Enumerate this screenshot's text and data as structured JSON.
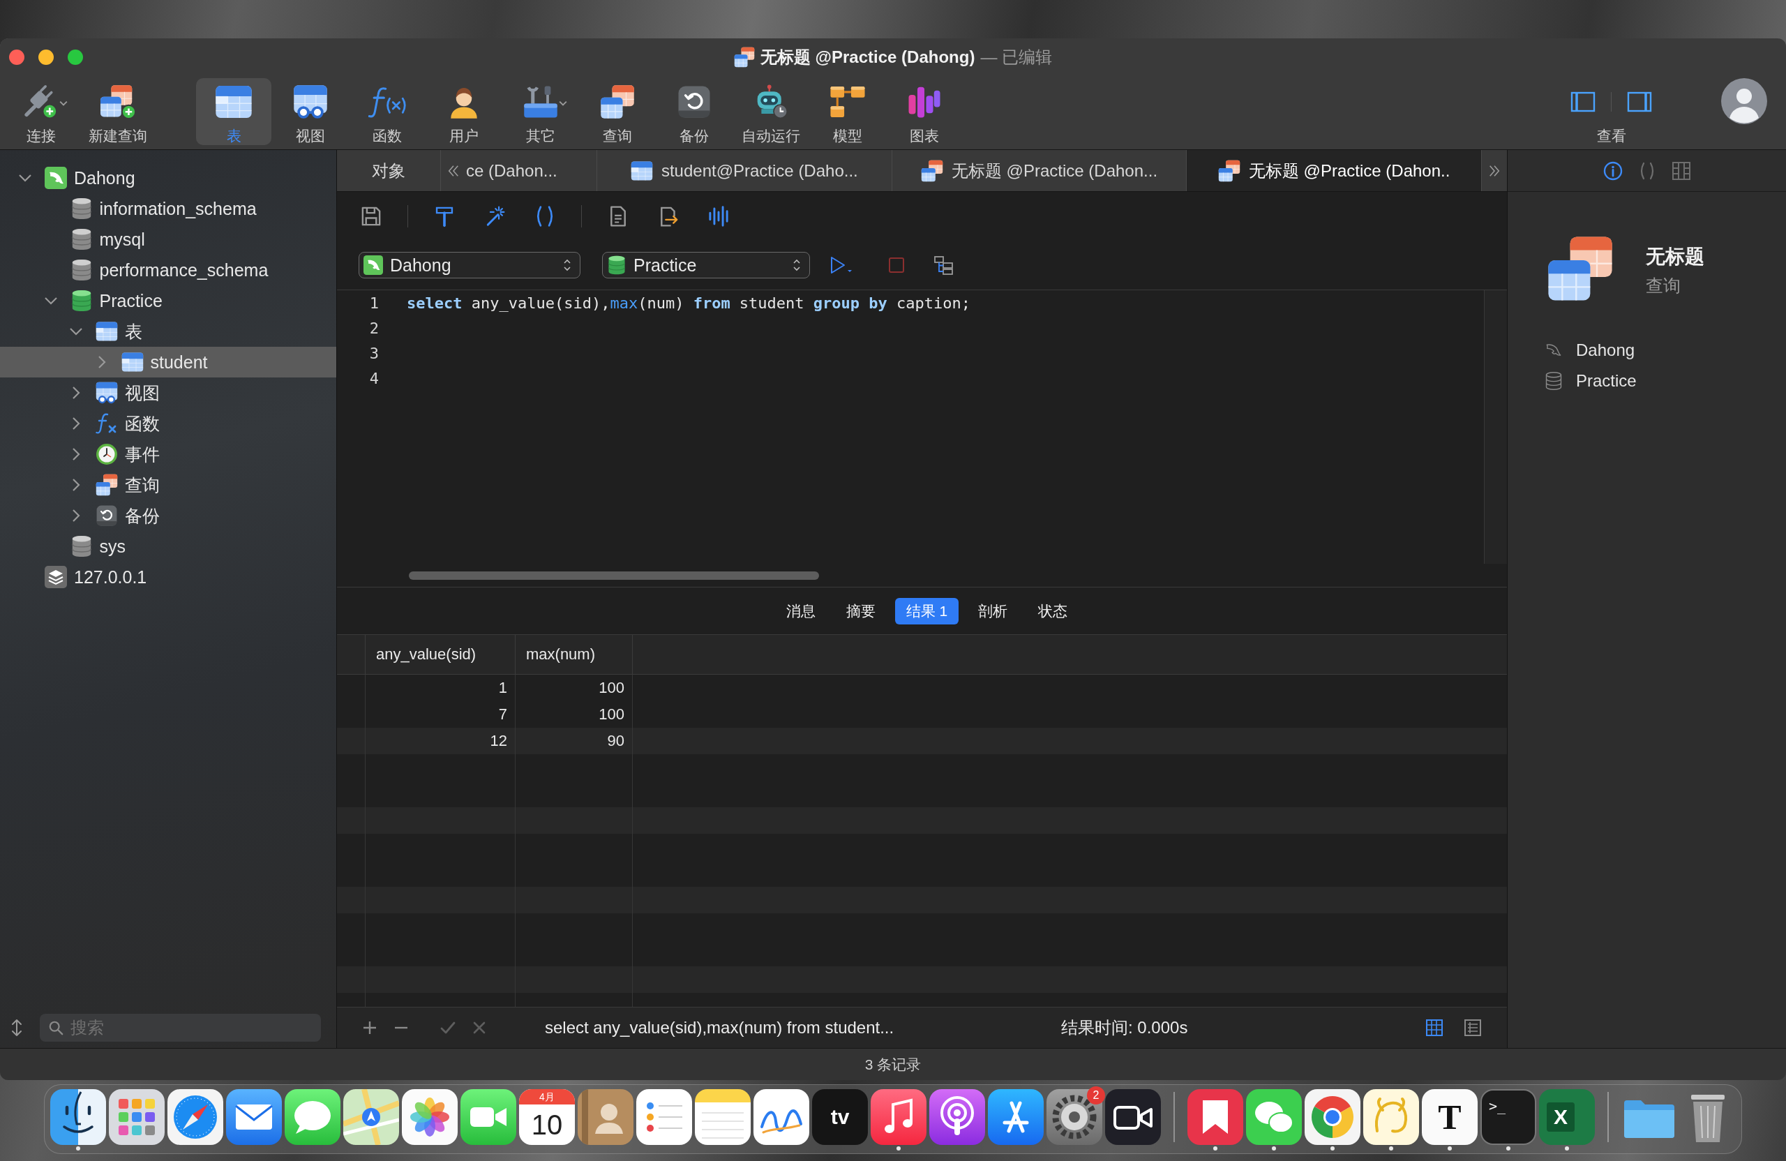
{
  "window": {
    "controls": [
      {
        "kind": "close"
      },
      {
        "kind": "minimize"
      },
      {
        "kind": "zoom"
      }
    ],
    "title": "无标题 @Practice (Dahong)",
    "status": "— 已编辑"
  },
  "toolbar": {
    "items": [
      {
        "label": "连接",
        "kind": "connect",
        "selected": false,
        "has_menu": true
      },
      {
        "label": "新建查询",
        "kind": "new-query",
        "selected": false,
        "has_menu": false
      },
      {
        "label": "表",
        "kind": "table",
        "selected": true,
        "has_menu": false
      },
      {
        "label": "视图",
        "kind": "view",
        "selected": false,
        "has_menu": false
      },
      {
        "label": "函数",
        "kind": "function",
        "selected": false,
        "has_menu": false
      },
      {
        "label": "用户",
        "kind": "user",
        "selected": false,
        "has_menu": false
      },
      {
        "label": "其它",
        "kind": "other",
        "selected": false,
        "has_menu": true
      },
      {
        "label": "查询",
        "kind": "query",
        "selected": false,
        "has_menu": false
      },
      {
        "label": "备份",
        "kind": "backup",
        "selected": false,
        "has_menu": false
      },
      {
        "label": "自动运行",
        "kind": "automation",
        "selected": false,
        "has_menu": false
      },
      {
        "label": "模型",
        "kind": "model",
        "selected": false,
        "has_menu": false
      },
      {
        "label": "图表",
        "kind": "chart",
        "selected": false,
        "has_menu": false
      }
    ],
    "view": {
      "label": "查看",
      "panes": [
        {
          "kind": "left",
          "on": true
        },
        {
          "kind": "right",
          "on": true
        }
      ]
    }
  },
  "sidebar": {
    "tree": [
      {
        "label": "Dahong",
        "kind": "connection",
        "expanded": true,
        "selected": false,
        "children": [
          {
            "label": "information_schema",
            "kind": "database",
            "selected": false
          },
          {
            "label": "mysql",
            "kind": "database",
            "selected": false
          },
          {
            "label": "performance_schema",
            "kind": "database",
            "selected": false
          },
          {
            "label": "Practice",
            "kind": "open-database",
            "expanded": true,
            "selected": false,
            "children": [
              {
                "label": "表",
                "kind": "tables",
                "expanded": true,
                "selected": false,
                "children": [
                  {
                    "label": "student",
                    "kind": "table",
                    "expanded": false,
                    "selected": true
                  }
                ]
              },
              {
                "label": "视图",
                "kind": "views",
                "expanded": false,
                "selected": false
              },
              {
                "label": "函数",
                "kind": "functions",
                "expanded": false,
                "selected": false
              },
              {
                "label": "事件",
                "kind": "events",
                "expanded": false,
                "selected": false
              },
              {
                "label": "查询",
                "kind": "queries",
                "expanded": false,
                "selected": false
              },
              {
                "label": "备份",
                "kind": "backups",
                "expanded": false,
                "selected": false
              }
            ]
          },
          {
            "label": "sys",
            "kind": "database",
            "selected": false
          }
        ]
      },
      {
        "label": "127.0.0.1",
        "kind": "server",
        "selected": false
      }
    ],
    "search": {
      "placeholder": "搜索"
    }
  },
  "tabs": [
    {
      "label": "对象",
      "kind": "text",
      "selected": false
    },
    {
      "label": "ce (Dahon...",
      "kind": "text",
      "selected": false
    },
    {
      "label": "student@Practice (Daho...",
      "kind": "table",
      "selected": false
    },
    {
      "label": "无标题 @Practice (Dahon...",
      "kind": "query",
      "selected": false
    },
    {
      "label": "无标题 @Practice (Dahon..",
      "kind": "query",
      "selected": true
    }
  ],
  "editor": {
    "connection": "Dahong",
    "database": "Practice",
    "lines": [
      {
        "number": "1",
        "tokens": [
          {
            "text": "select",
            "kind": "keyword"
          },
          {
            "text": " any_value(sid),",
            "kind": "plain"
          },
          {
            "text": "max",
            "kind": "function"
          },
          {
            "text": "(num) ",
            "kind": "plain"
          },
          {
            "text": "from",
            "kind": "keyword"
          },
          {
            "text": " student ",
            "kind": "plain"
          },
          {
            "text": "group by",
            "kind": "keyword"
          },
          {
            "text": " caption;",
            "kind": "plain"
          }
        ]
      },
      {
        "number": "2"
      },
      {
        "number": "3"
      },
      {
        "number": "4"
      }
    ]
  },
  "results": {
    "tabs": [
      {
        "label": "消息",
        "selected": false
      },
      {
        "label": "摘要",
        "selected": false
      },
      {
        "label": "结果 1",
        "selected": true
      },
      {
        "label": "剖析",
        "selected": false
      },
      {
        "label": "状态",
        "selected": false
      }
    ],
    "columns": [
      "any_value(sid)",
      "max(num)"
    ],
    "rows": [
      [
        "1",
        "100"
      ],
      [
        "7",
        "100"
      ],
      [
        "12",
        "90"
      ]
    ],
    "footer": {
      "actions": [
        {
          "kind": "add",
          "disabled": false
        },
        {
          "kind": "remove",
          "disabled": false
        },
        {
          "kind": "apply",
          "disabled": true
        },
        {
          "kind": "discard",
          "disabled": true
        }
      ],
      "query": "select any_value(sid),max(num) from student...",
      "time": "结果时间: 0.000s",
      "views": [
        {
          "kind": "grid",
          "selected": true
        },
        {
          "kind": "form",
          "selected": false
        }
      ]
    }
  },
  "inspector": {
    "tabs": [
      {
        "kind": "info",
        "selected": true
      },
      {
        "kind": "ddl",
        "selected": false
      },
      {
        "kind": "preview",
        "selected": false
      }
    ],
    "name": "无标题",
    "type": "查询",
    "details": [
      {
        "kind": "connection",
        "text": "Dahong"
      },
      {
        "kind": "database",
        "text": "Practice"
      }
    ]
  },
  "status_bar": {
    "text": "3 条记录"
  },
  "dock": {
    "groups": [
      {
        "items": [
          {
            "kind": "finder",
            "running": true
          },
          {
            "kind": "launchpad",
            "running": false
          },
          {
            "kind": "safari",
            "running": false
          },
          {
            "kind": "mail",
            "running": false
          },
          {
            "kind": "messages",
            "running": false
          },
          {
            "kind": "maps",
            "running": false
          },
          {
            "kind": "photos",
            "running": false
          },
          {
            "kind": "facetime",
            "running": false
          },
          {
            "kind": "calendar",
            "month": "4月",
            "day": "10",
            "running": false
          },
          {
            "kind": "contacts",
            "running": false
          },
          {
            "kind": "reminders",
            "running": false
          },
          {
            "kind": "notes",
            "running": false
          },
          {
            "kind": "freeform",
            "running": false
          },
          {
            "kind": "tv",
            "label": "tv",
            "running": false
          },
          {
            "kind": "music",
            "running": true
          },
          {
            "kind": "podcasts",
            "running": false
          },
          {
            "kind": "appstore",
            "running": false
          },
          {
            "kind": "settings",
            "badge": "2",
            "running": false
          },
          {
            "kind": "camera",
            "running": false
          }
        ]
      },
      {
        "items": [
          {
            "kind": "ribbon",
            "running": true
          },
          {
            "kind": "wechat",
            "running": true
          },
          {
            "kind": "chrome",
            "running": true
          },
          {
            "kind": "navicat",
            "running": true
          },
          {
            "kind": "typora",
            "label": "T",
            "running": true
          },
          {
            "kind": "terminal",
            "label": ">_",
            "running": true
          },
          {
            "kind": "excel",
            "label": "X",
            "running": true
          }
        ]
      },
      {
        "items": [
          {
            "kind": "folder",
            "running": false
          },
          {
            "kind": "trash",
            "running": false
          }
        ]
      }
    ]
  }
}
